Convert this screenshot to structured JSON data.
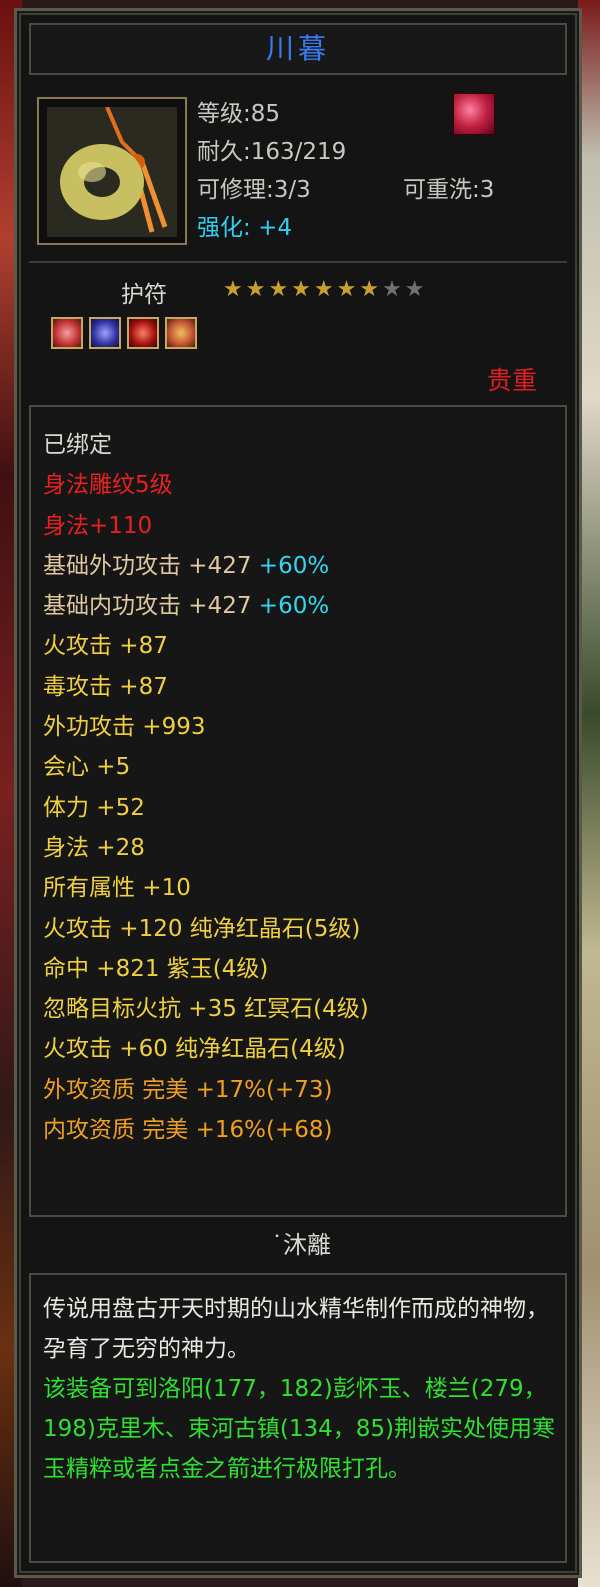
{
  "item": {
    "name": "川暮",
    "level": "等级:85",
    "durability": "耐久:163/219",
    "repairable": "可修理:3/3",
    "rewash": "可重洗:3",
    "enhance_label": "强化:",
    "enhance_value": "+4",
    "type": "护符",
    "stars_on": "★★★★★★★",
    "stars_off": "★★",
    "rarity": "贵重"
  },
  "attributes": [
    {
      "text": "已绑定",
      "color": "white"
    },
    {
      "text": "身法雕纹5级",
      "color": "red"
    },
    {
      "text": "身法+110",
      "color": "red"
    },
    {
      "text": "基础外功攻击 +427",
      "extra": "+60%",
      "color": "tan"
    },
    {
      "text": "基础内功攻击 +427",
      "extra": "+60%",
      "color": "tan"
    },
    {
      "text": "火攻击 +87",
      "color": "yellow"
    },
    {
      "text": "毒攻击 +87",
      "color": "yellow"
    },
    {
      "text": "外功攻击 +993",
      "color": "yellow"
    },
    {
      "text": "会心 +5",
      "color": "yellow"
    },
    {
      "text": "体力 +52",
      "color": "yellow"
    },
    {
      "text": "身法 +28",
      "color": "yellow"
    },
    {
      "text": "所有属性 +10",
      "color": "yellow"
    },
    {
      "text": "火攻击 +120 纯净红晶石(5级)",
      "color": "yellow"
    },
    {
      "text": "命中 +821 紫玉(4级)",
      "color": "yellow"
    },
    {
      "text": "忽略目标火抗 +35 红冥石(4级)",
      "color": "yellow"
    },
    {
      "text": "火攻击 +60 纯净红晶石(4级)",
      "color": "yellow"
    },
    {
      "text": "外攻资质  完美 +17%(+73)",
      "color": "orange"
    },
    {
      "text": "内攻资质  完美 +16%(+68)",
      "color": "orange"
    }
  ],
  "set_name": "˙沐離",
  "description": {
    "lore": "传说用盘古开天时期的山水精华制作而成的神物，孕育了无穷的神力。",
    "hint": "该装备可到洛阳(177，182)彭怀玉、楼兰(279，198)克里木、束河古镇(134，85)荆嵌实处使用寒玉精粹或者点金之箭进行极限打孔。"
  }
}
